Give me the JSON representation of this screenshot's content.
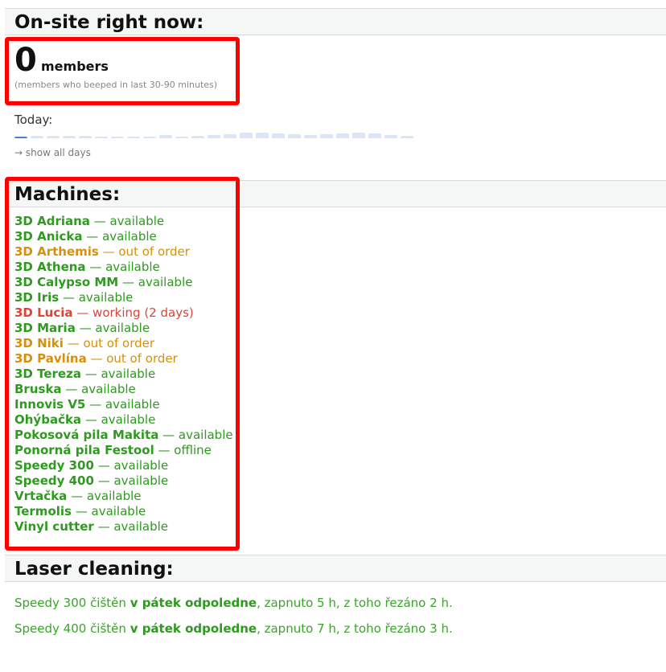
{
  "onsite": {
    "heading": "On-site right now:",
    "count": "0",
    "unit": "members",
    "note": "(members who beeped in last 30-90 minutes)",
    "today_label": "Today:",
    "today_bars": [
      0.05,
      0.25,
      0.25,
      0.25,
      0.25,
      0.15,
      0.15,
      0.15,
      0.15,
      0.35,
      0.15,
      0.3,
      0.4,
      0.5,
      0.7,
      0.7,
      0.6,
      0.5,
      0.4,
      0.5,
      0.6,
      0.7,
      0.6,
      0.4,
      0.3
    ],
    "show_days": "→ show all days"
  },
  "machines": {
    "heading": "Machines:",
    "items": [
      {
        "name": "3D Adriana",
        "status": " — available",
        "state": "available"
      },
      {
        "name": "3D Anicka",
        "status": " — available",
        "state": "available"
      },
      {
        "name": "3D Arthemis",
        "status": " — out of order",
        "state": "outoforder"
      },
      {
        "name": "3D Athena",
        "status": " — available",
        "state": "available"
      },
      {
        "name": "3D Calypso MM",
        "status": " — available",
        "state": "available"
      },
      {
        "name": "3D Iris",
        "status": " — available",
        "state": "available"
      },
      {
        "name": "3D Lucia",
        "status": " — working (2 days)",
        "state": "working"
      },
      {
        "name": "3D Maria",
        "status": " — available",
        "state": "available"
      },
      {
        "name": "3D Niki",
        "status": " — out of order",
        "state": "outoforder"
      },
      {
        "name": "3D Pavlína",
        "status": " — out of order",
        "state": "outoforder"
      },
      {
        "name": "3D Tereza",
        "status": " — available",
        "state": "available"
      },
      {
        "name": "Bruska",
        "status": " — available",
        "state": "available"
      },
      {
        "name": "Innovis V5",
        "status": " — available",
        "state": "available"
      },
      {
        "name": "Ohýbačka",
        "status": " — available",
        "state": "available"
      },
      {
        "name": "Pokosová pila Makita",
        "status": " — available",
        "state": "available"
      },
      {
        "name": "Ponorná pila Festool",
        "status": " — offline",
        "state": "offline"
      },
      {
        "name": "Speedy 300",
        "status": " — available",
        "state": "available"
      },
      {
        "name": "Speedy 400",
        "status": " — available",
        "state": "available"
      },
      {
        "name": "Vrtačka",
        "status": " — available",
        "state": "available"
      },
      {
        "name": "Termolis",
        "status": " — available",
        "state": "available"
      },
      {
        "name": "Vinyl cutter",
        "status": " — available",
        "state": "available"
      }
    ]
  },
  "laser": {
    "heading": "Laser cleaning:",
    "lines": [
      {
        "prefix": "Speedy 300 čištěn ",
        "when": "v pátek odpoledne",
        "suffix": ", zapnuto 5 h, z toho řezáno 2 h."
      },
      {
        "prefix": "Speedy 400 čištěn ",
        "when": "v pátek odpoledne",
        "suffix": ", zapnuto 7 h, z toho řezáno 3 h."
      }
    ]
  },
  "colors": {
    "available": "#2e9a1f",
    "outoforder": "#d6900b",
    "working": "#d9453b",
    "highlight": "#ff0000"
  }
}
